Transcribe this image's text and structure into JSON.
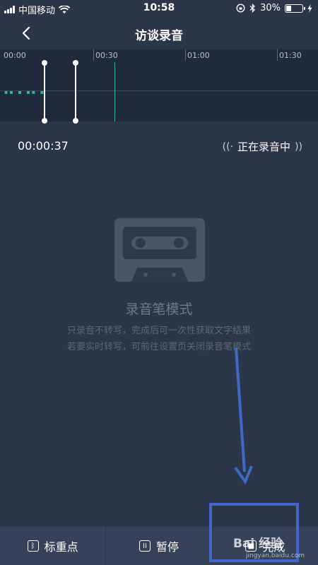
{
  "status_bar": {
    "carrier": "中国移动",
    "time": "10:58",
    "battery_percent": "30%"
  },
  "nav": {
    "title": "访谈录音"
  },
  "timeline": {
    "ticks": [
      "00:00",
      "00:30",
      "01:00",
      "01:30"
    ]
  },
  "recording": {
    "elapsed": "00:00:37",
    "status_label": "正在录音中"
  },
  "mode": {
    "title": "录音笔模式",
    "desc_line1": "只录音不转写，完成后可一次性获取文字结果",
    "desc_line2": "若要实时转写，可前往设置页关闭录音笔模式"
  },
  "bottom_bar": {
    "mark_label": "标重点",
    "pause_label": "暂停",
    "finish_label": "完成"
  },
  "watermark": {
    "logo_text": "Bai 经验",
    "url": "jingyan.baidu.com"
  },
  "colors": {
    "background": "#2b3649",
    "timeline_bg": "#1f2a3b",
    "accent": "#2fb6a0",
    "annotation_blue": "#3f69c6"
  }
}
